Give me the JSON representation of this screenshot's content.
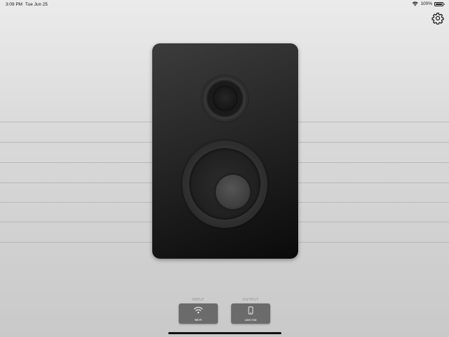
{
  "status_bar": {
    "time": "3:09 PM",
    "date": "Tue Jun 25",
    "battery_text": "100%",
    "battery_level": 1.0
  },
  "toolbar": {
    "settings_icon": "gear-icon"
  },
  "speaker": {
    "icon": "speaker-graphic"
  },
  "io": {
    "input_label": "INPUT",
    "input_button_label": "Wi-Fi",
    "input_icon": "wifi-icon",
    "output_label": "OUTPUT",
    "output_button_label": "Line Out",
    "output_icon": "phone-icon"
  },
  "colors": {
    "background": "#d9d9d9",
    "speaker": "#262626",
    "button": "#6b6b6b"
  }
}
